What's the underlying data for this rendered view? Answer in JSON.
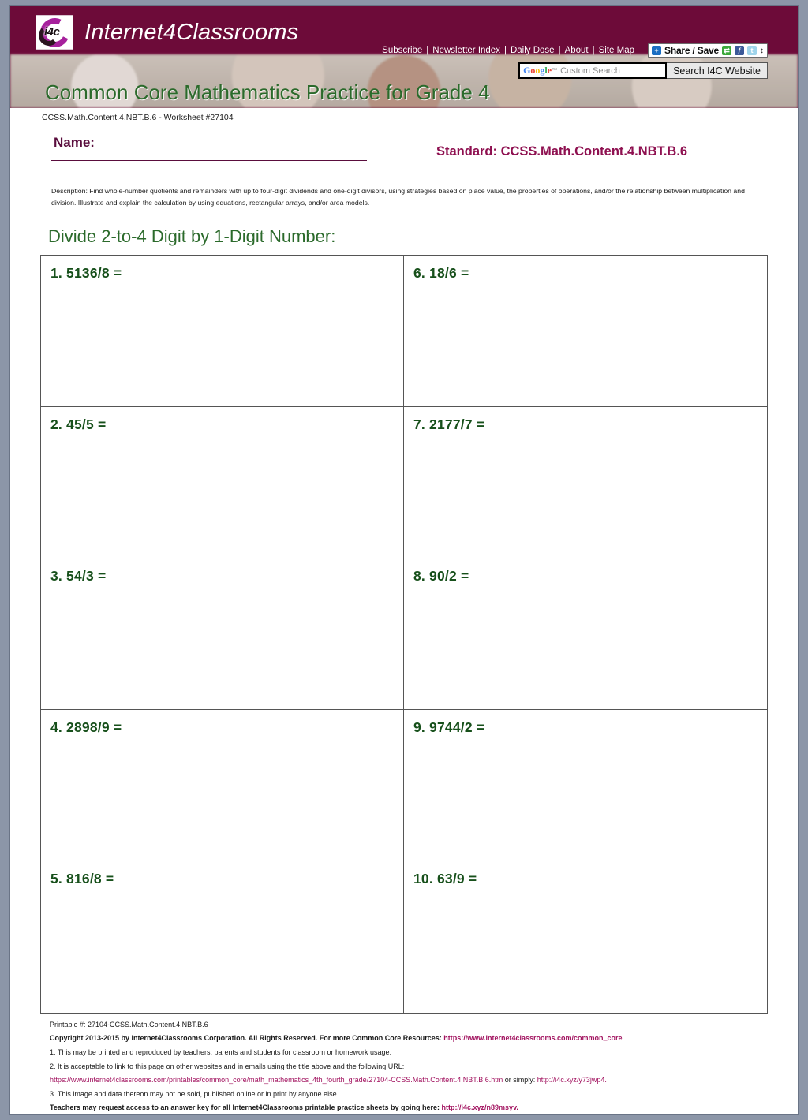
{
  "site": {
    "brand_name": "Internet4Classrooms",
    "logo_text": "i4c",
    "nav_links": [
      "Subscribe",
      "Newsletter Index",
      "Daily Dose",
      "About",
      "Site Map"
    ],
    "share_label": "Share / Save",
    "search_placeholder": "Custom Search",
    "search_google_word": "Google",
    "search_button": "Search I4C Website"
  },
  "header": {
    "page_title": "Common Core Mathematics Practice for Grade 4",
    "worksheet_id_line": "CCSS.Math.Content.4.NBT.B.6 - Worksheet #27104"
  },
  "form": {
    "name_label": "Name:",
    "standard_label": "Standard: CCSS.Math.Content.4.NBT.B.6",
    "description": "Description: Find whole-number quotients and remainders with up to four-digit dividends and one-digit divisors, using strategies based on place value, the properties of operations, and/or the relationship between multiplication and division. Illustrate and explain the calculation by using equations, rectangular arrays, and/or area models."
  },
  "worksheet": {
    "section_title": "Divide 2-to-4 Digit by 1-Digit Number:",
    "problems": [
      "1. 5136/8 =",
      "6. 18/6 =",
      "2. 45/5 =",
      "7. 2177/7 =",
      "3. 54/3 =",
      "8. 90/2 =",
      "4. 2898/9 =",
      "9. 9744/2 =",
      "5. 816/8 =",
      "10. 63/9 ="
    ]
  },
  "footer": {
    "printable": "Printable #: 27104-CCSS.Math.Content.4.NBT.B.6",
    "copyright_text": "Copyright 2013-2015 by Internet4Classrooms Corporation. All Rights Reserved. For more Common Core Resources: ",
    "copyright_link": "https://www.internet4classrooms.com/common_core",
    "line1": "1. This may be printed and reproduced by teachers, parents and students for classroom or homework usage.",
    "line2": "2. It is acceptable to link to this page on other websites and in emails using the title above and the following URL:",
    "url_long": "https://www.internet4classrooms.com/printables/common_core/math_mathematics_4th_fourth_grade/27104-CCSS.Math.Content.4.NBT.B.6.htm",
    "url_middle": " or simply: ",
    "url_short": "http://i4c.xyz/y73jwp4.",
    "line3": "3. This image and data thereon may not be sold, published online or in print by anyone else.",
    "answer_key_text": "Teachers may request access to an answer key for all Internet4Classrooms printable practice sheets by going here: ",
    "answer_key_link": "http://i4c.xyz/n89msyv."
  },
  "colors": {
    "brand_maroon": "#6d0b39",
    "heading_green": "#2b6a2b",
    "problem_green": "#17501b",
    "standard_pink": "#8e1050",
    "link_pink": "#a1115e"
  }
}
